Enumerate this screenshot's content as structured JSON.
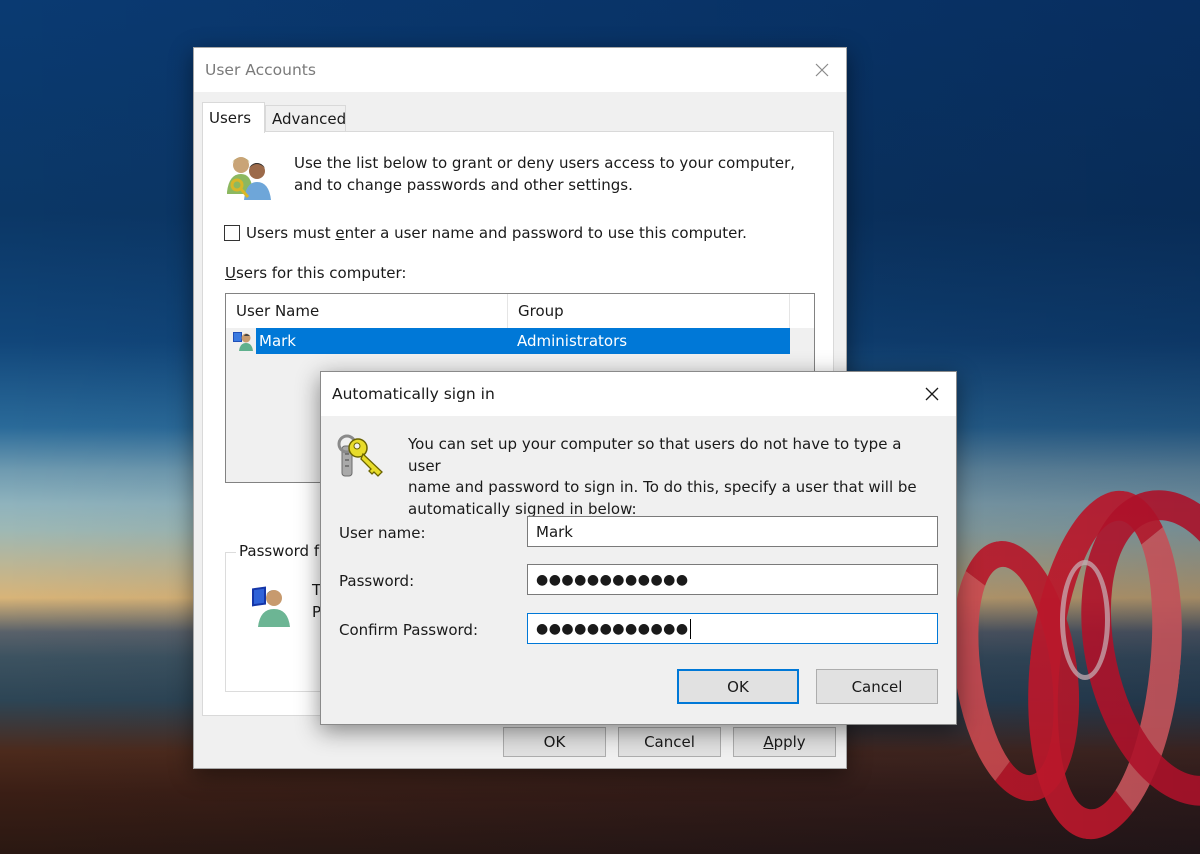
{
  "desktop": {
    "wallpaper": "night-seascape-light-painting"
  },
  "user_accounts": {
    "title": "User Accounts",
    "close_icon": "close-icon",
    "tabs": [
      {
        "label": "Users",
        "active": true
      },
      {
        "label": "Advanced",
        "active": false
      }
    ],
    "intro_icon": "users-key-icon",
    "intro_text_line1": "Use the list below to grant or deny users access to your computer,",
    "intro_text_line2": "and to change passwords and other settings.",
    "require_password": {
      "checked": false,
      "label_pre": "Users must ",
      "label_accel": "e",
      "label_post": "nter a user name and password to use this computer."
    },
    "users_label": {
      "accel": "U",
      "rest": "sers for this computer:"
    },
    "users_table": {
      "columns": [
        "User Name",
        "Group"
      ],
      "rows": [
        {
          "icon": "user-computer-icon",
          "user_name": "Mark",
          "group": "Administrators",
          "selected": true
        }
      ]
    },
    "password_group": {
      "legend": "Password fo",
      "icon": "user-password-icon",
      "text_line1": "T",
      "text_line2": "P"
    },
    "buttons": {
      "ok": "OK",
      "cancel": "Cancel",
      "apply_accel": "A",
      "apply_rest": "pply"
    }
  },
  "auto_sign_in": {
    "title": "Automatically sign in",
    "close_icon": "close-icon",
    "icon": "keys-icon",
    "description_line1": "You can set up your computer so that users do not have to type a user",
    "description_line2": "name and password to sign in. To do this, specify a user that will be",
    "description_line3": "automatically signed in below:",
    "fields": {
      "user_name": {
        "label": "User name:",
        "value": "Mark"
      },
      "password": {
        "label": "Password:",
        "value": "●●●●●●●●●●●●"
      },
      "confirm_password": {
        "label": "Confirm Password:",
        "value": "●●●●●●●●●●●●",
        "focused": true
      }
    },
    "buttons": {
      "ok": "OK",
      "cancel": "Cancel"
    }
  },
  "colors": {
    "accent": "#0078d7",
    "selection": "#0078d7",
    "dialog_bg": "#f0f0f0",
    "button_bg": "#e1e1e1"
  }
}
